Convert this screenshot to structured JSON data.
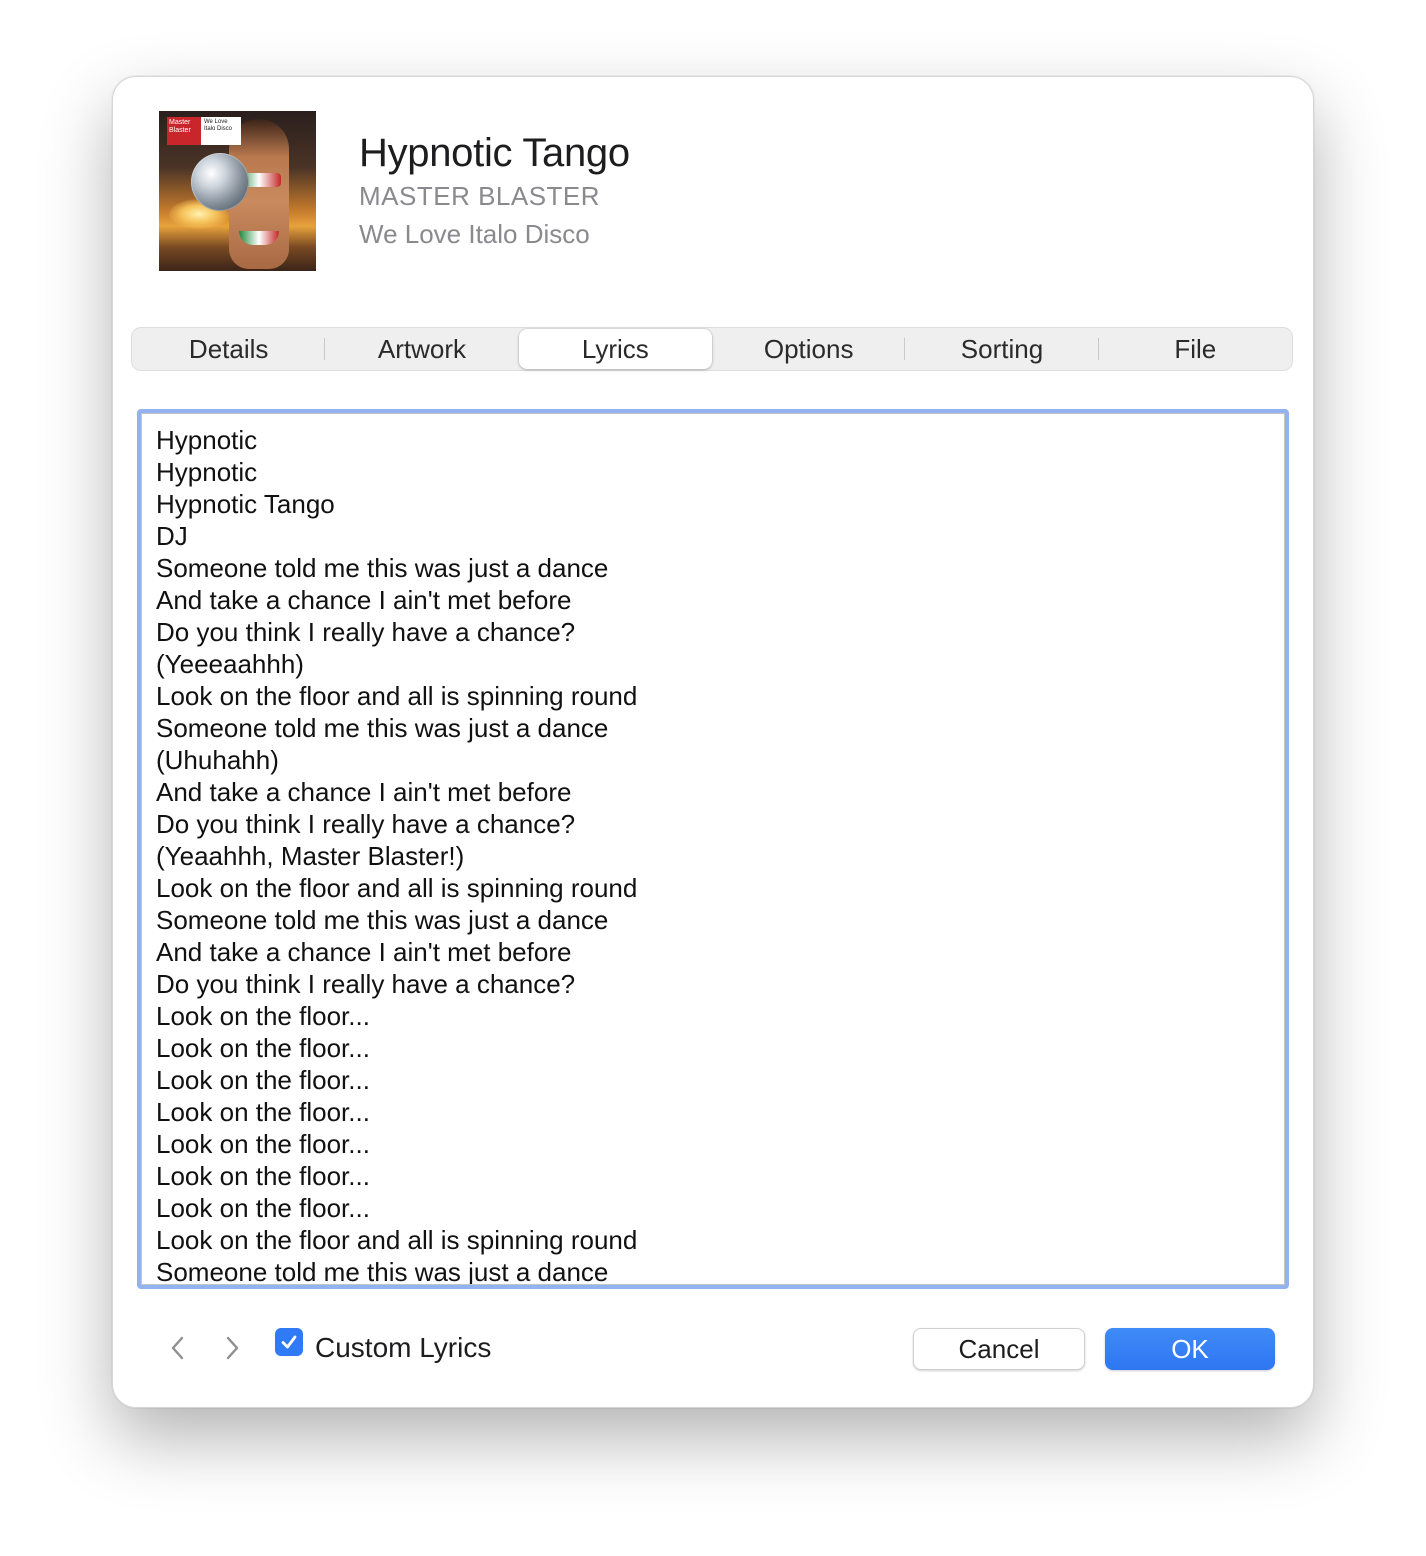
{
  "track": {
    "title": "Hypnotic Tango",
    "artist": "MASTER BLASTER",
    "album": "We Love Italo Disco",
    "artwork_label_left": "Master Blaster",
    "artwork_label_right": "We Love Italo Disco"
  },
  "tabs": [
    {
      "label": "Details",
      "active": false
    },
    {
      "label": "Artwork",
      "active": false
    },
    {
      "label": "Lyrics",
      "active": true
    },
    {
      "label": "Options",
      "active": false
    },
    {
      "label": "Sorting",
      "active": false
    },
    {
      "label": "File",
      "active": false
    }
  ],
  "lyrics": [
    "Hypnotic",
    "Hypnotic",
    "Hypnotic Tango",
    "DJ",
    "Someone told me this was just a dance",
    "And take a chance I ain't met before",
    "Do you think I really have a chance?",
    "(Yeeeaahhh)",
    "Look on the floor and all is spinning round",
    "Someone told me this was just a dance",
    "(Uhuhahh)",
    "And take a chance I ain't met before",
    "Do you think I really have a chance?",
    "(Yeaahhh, Master Blaster!)",
    "Look on the floor and all is spinning round",
    "Someone told me this was just a dance",
    "And take a chance I ain't met before",
    "Do you think I really have a chance?",
    "Look on the floor...",
    "Look on the floor...",
    "Look on the floor...",
    "Look on the floor...",
    "Look on the floor...",
    "Look on the floor...",
    "Look on the floor...",
    "Look on the floor and all is spinning round",
    "Someone told me this was just a dance"
  ],
  "footer": {
    "custom_lyrics_label": "Custom Lyrics",
    "custom_lyrics_checked": true,
    "cancel_label": "Cancel",
    "ok_label": "OK"
  },
  "icons": {
    "prev": "chevron-left-icon",
    "next": "chevron-right-icon",
    "check": "checkmark-icon"
  },
  "colors": {
    "accent": "#2f7bf6",
    "focus_ring": "#92b2f0",
    "secondary_text": "#8a8a8e",
    "spellcheck_underline": "#e0443e"
  }
}
